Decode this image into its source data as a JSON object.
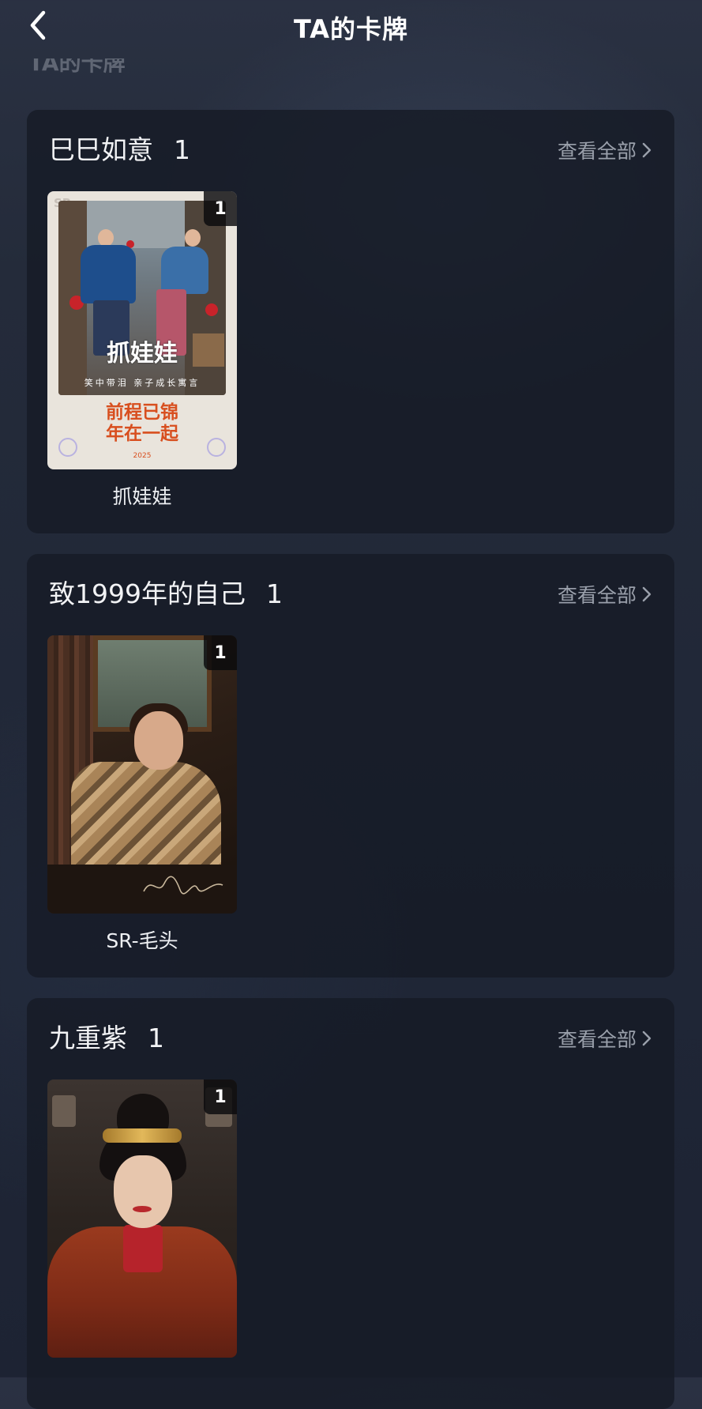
{
  "header": {
    "title": "TA的卡牌",
    "faded_subtitle": "TA的卡牌"
  },
  "sections": [
    {
      "title": "巳巳如意",
      "count": "1",
      "see_all_label": "查看全部",
      "cards": [
        {
          "name": "抓娃娃",
          "badge": "1",
          "art_text": {
            "corner": "SR",
            "title": "抓娃娃",
            "tagline": "笑中带泪 亲子成长寓言",
            "slogan_line1": "前程已锦",
            "slogan_line2": "年在一起",
            "year": "2025"
          }
        }
      ]
    },
    {
      "title": "致1999年的自己",
      "count": "1",
      "see_all_label": "查看全部",
      "cards": [
        {
          "name": "SR-毛头",
          "badge": "1"
        }
      ]
    },
    {
      "title": "九重紫",
      "count": "1",
      "see_all_label": "查看全部",
      "cards": [
        {
          "badge": "1"
        }
      ]
    }
  ],
  "icons": {
    "back": "chevron-left-icon",
    "see_all": "chevron-right-icon"
  },
  "colors": {
    "background": "#232a39",
    "section_bg": "#161b26",
    "text_primary": "#ffffff",
    "text_secondary": "#9aa0ab",
    "badge_bg": "#0a0a0c"
  }
}
